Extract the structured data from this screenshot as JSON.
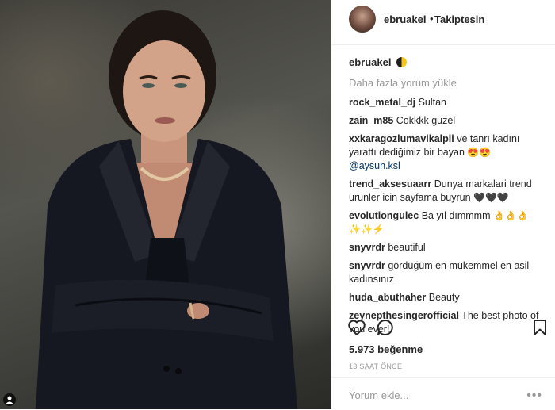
{
  "header": {
    "username": "ebruakel",
    "separator": "•",
    "follow_status": "Takiptesin"
  },
  "caption": {
    "username": "ebruakel"
  },
  "load_more": "Daha fazla yorum yükle",
  "comments": [
    {
      "user": "rock_metal_dj",
      "text": "Sultan"
    },
    {
      "user": "zain_m85",
      "text": "Cokkkk guzel"
    },
    {
      "user": "xxkaragozlumavikalpli",
      "text": "ve tanrı kadını yarattı dediğimiz bir bayan",
      "emoji": "😍😍",
      "mention": "@aysun.ksl"
    },
    {
      "user": "trend_aksesuaarr",
      "text": "Dunya markalari trend urunler icin sayfama buyrun",
      "emoji": "🖤🖤🖤"
    },
    {
      "user": "evolutiongulec",
      "text": "Ba yıl dımmmm",
      "emoji": "👌👌👌 ✨✨⚡"
    },
    {
      "user": "snyvrdr",
      "text": "beautiful"
    },
    {
      "user": "snyvrdr",
      "text": "gördüğüm en mükemmel en asil kadınsınız"
    },
    {
      "user": "huda_abuthaher",
      "text": "Beauty"
    },
    {
      "user": "zeynepthesingerofficial",
      "text": "The best photo of vou ever!"
    }
  ],
  "likes": "5.973 beğenme",
  "time_ago": "13 SAAT ÖNCE",
  "comment_input": {
    "placeholder": "Yorum ekle..."
  },
  "icons": {
    "like": "heart-icon",
    "comment": "comment-icon",
    "save": "bookmark-icon",
    "more": "more-options-icon",
    "tagged": "tagged-user-icon"
  },
  "colors": {
    "text": "#262626",
    "muted": "#999999",
    "mention": "#003569",
    "border": "#efefef"
  }
}
